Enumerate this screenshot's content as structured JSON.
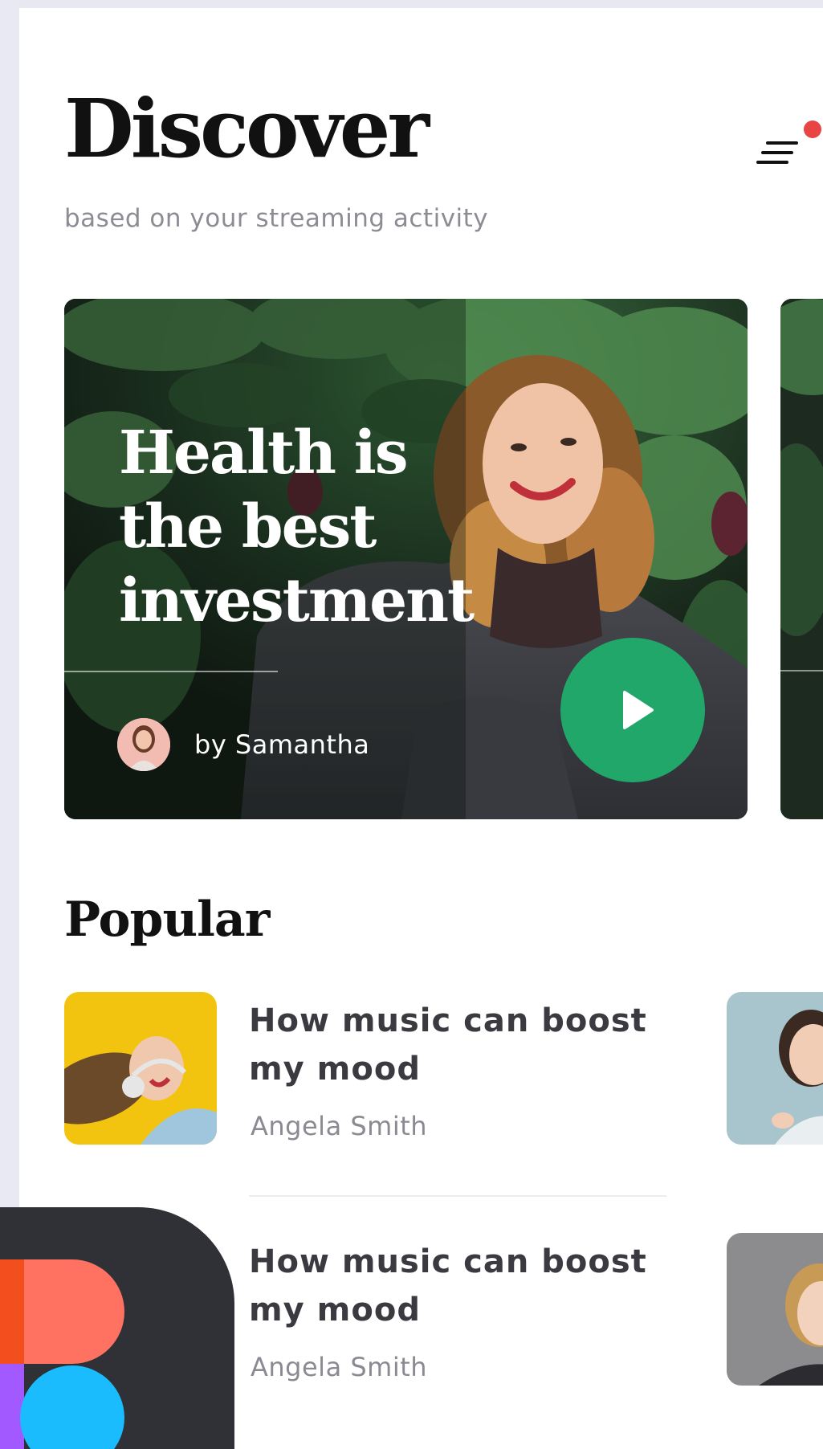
{
  "header": {
    "title": "Discover",
    "subtitle": "based on your streaming activity",
    "menu_icon": "menu-lines-icon",
    "notification_color": "#e84444"
  },
  "featured": {
    "title_lines": [
      "Health is",
      "the best",
      "investment"
    ],
    "author": "by Samantha",
    "play_icon": "play-icon",
    "play_color": "#22a76b"
  },
  "popular": {
    "title": "Popular",
    "items": [
      {
        "title": "How music can boost my mood",
        "author": "Angela Smith"
      },
      {
        "title": "How music can boost my mood",
        "author": "Angela Smith"
      }
    ]
  },
  "badge": {
    "icon": "figma-logo-icon",
    "colors": [
      "#f24e1e",
      "#ff7262",
      "#a259ff",
      "#1abcfe"
    ]
  }
}
